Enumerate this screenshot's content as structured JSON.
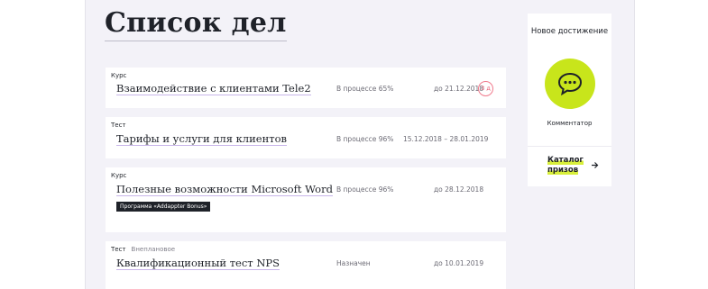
{
  "page": {
    "title": "Список дел"
  },
  "tasks": [
    {
      "kind": "Курс",
      "extra": "",
      "name": "Взаимодействие с клиентами Tele2",
      "status": "В процессе 65%",
      "date": "до 21.12.2018",
      "badge": "3 д",
      "program": ""
    },
    {
      "kind": "Тест",
      "extra": "",
      "name": "Тарифы и услуги для клиентов",
      "status": "В процессе 96%",
      "date": "15.12.2018 – 28.01.2019",
      "badge": "",
      "program": ""
    },
    {
      "kind": "Курс",
      "extra": "",
      "name": "Полезные возможности Microsoft Word",
      "status": "В процессе 96%",
      "date": "до 28.12.2018",
      "badge": "",
      "program": "Программа «Addappter Bonus»"
    },
    {
      "kind": "Тест",
      "extra": "Внеплановое",
      "name": "Квалификационный тест NPS",
      "status": "Назначен",
      "date": "до 10.01.2019",
      "badge": "",
      "program": ""
    }
  ],
  "achievement": {
    "title": "Новое достижение",
    "icon": "speech-bubble-icon",
    "caption": "Комментатор",
    "catalog_line1": "Каталог",
    "catalog_line2": "призов",
    "arrow_icon": "arrow-right-icon"
  },
  "colors": {
    "panel_bg": "#f3f2f8",
    "accent_lime": "#c8e51b",
    "badge_pink": "#f07a8c",
    "text_dark": "#1f2229"
  }
}
